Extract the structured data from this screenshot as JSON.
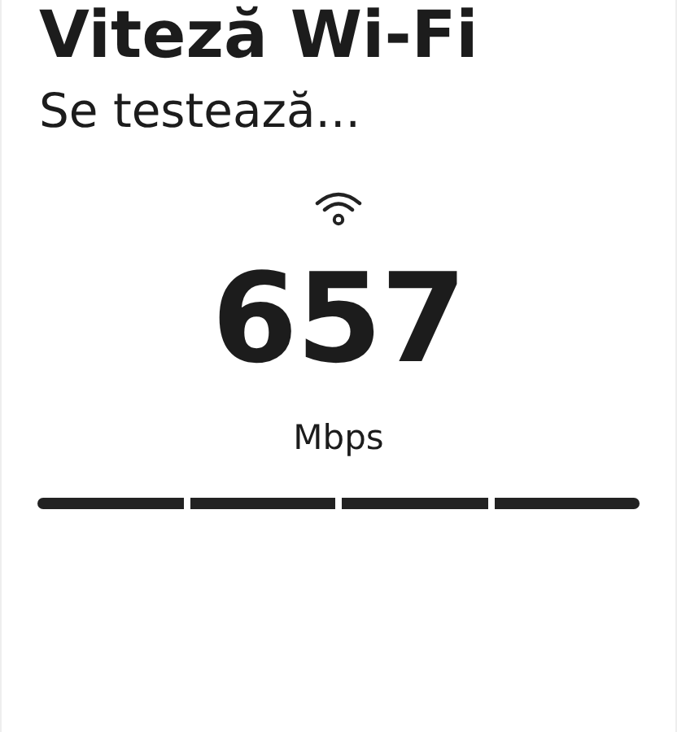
{
  "title": "Viteză Wi-Fi",
  "status": "Se testează...",
  "speed": {
    "value": "657",
    "unit": "Mbps"
  },
  "progress_segments": [
    {
      "done": true
    },
    {
      "done": true
    },
    {
      "done": true
    },
    {
      "done": true
    }
  ]
}
